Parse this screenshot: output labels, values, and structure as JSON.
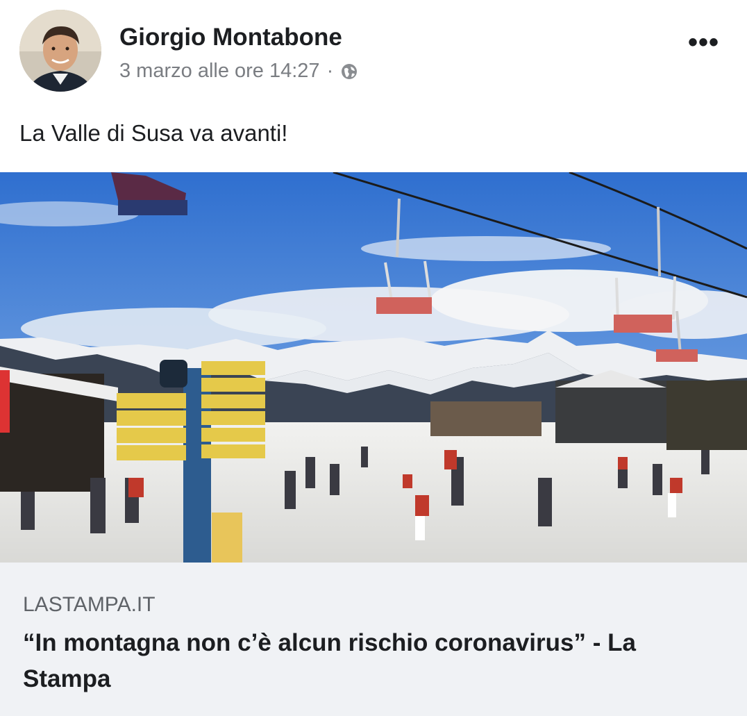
{
  "post": {
    "author": "Giorgio Montabone",
    "timestamp": "3 marzo alle ore 14:27",
    "separator": "·",
    "audience_icon": "globe-icon",
    "more_icon": "•••",
    "text": "La Valle di Susa va avanti!"
  },
  "link": {
    "domain": "LASTAMPA.IT",
    "title": "“In montagna non c’è alcun rischio coronavirus” - La Stampa"
  }
}
